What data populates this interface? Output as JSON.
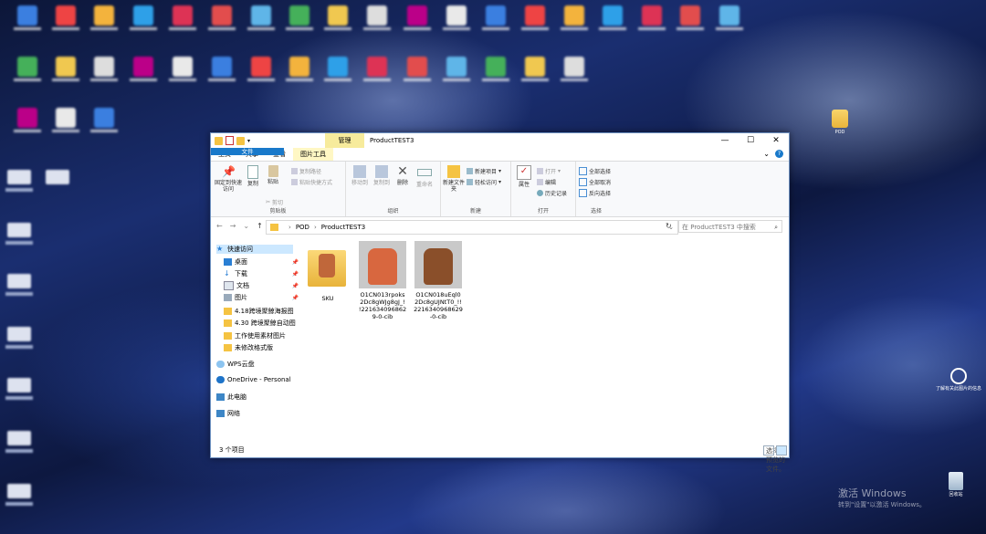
{
  "desktop": {
    "right_icons": [
      {
        "label": "POD",
        "icon": "folder-icon"
      },
      {
        "label": "了解有关此图片的信息",
        "icon": "info-camera-icon"
      },
      {
        "label": "回收站",
        "icon": "recycle-bin-icon"
      }
    ],
    "watermark_line1": "激活 Windows",
    "watermark_line2": "转到\"设置\"以激活 Windows。"
  },
  "explorer": {
    "title": "ProductTEST3",
    "manage_tab": "管理",
    "tabs": [
      {
        "label": "文件"
      },
      {
        "label": "主页"
      },
      {
        "label": "共享"
      },
      {
        "label": "查看"
      },
      {
        "label": "图片工具"
      }
    ],
    "ribbon": {
      "clipboard": {
        "pin": "固定到快速访问",
        "copy": "复制",
        "paste": "粘贴",
        "cut": "剪切",
        "copy_path": "复制路径",
        "paste_shortcut": "粘贴快捷方式",
        "group": "剪贴板"
      },
      "organize": {
        "move_to": "移动到",
        "copy_to": "复制到",
        "delete": "删除",
        "rename": "重命名",
        "group": "组织"
      },
      "new": {
        "new_folder": "新建文件夹",
        "new_item": "新建项目",
        "easy_access": "轻松访问",
        "group": "新建"
      },
      "open": {
        "properties": "属性",
        "open": "打开",
        "edit": "编辑",
        "history": "历史记录",
        "group": "打开"
      },
      "select": {
        "select_all": "全部选择",
        "select_none": "全部取消",
        "invert": "反向选择",
        "group": "选择"
      }
    },
    "address": {
      "crumbs": [
        "POD",
        "ProductTEST3"
      ],
      "search_placeholder": "在 ProductTEST3 中搜索"
    },
    "nav_pane": [
      {
        "label": "快速访问",
        "icon": "star-icon",
        "selected": true
      },
      {
        "label": "桌面",
        "icon": "desktop-icon",
        "pinned": true
      },
      {
        "label": "下载",
        "icon": "download-icon",
        "pinned": true
      },
      {
        "label": "文档",
        "icon": "document-icon",
        "pinned": true
      },
      {
        "label": "图片",
        "icon": "picture-icon",
        "pinned": true
      },
      {
        "label": "4.18跨境聚鲸海报图",
        "icon": "folder-icon"
      },
      {
        "label": "4.30 跨境聚鲸自动图",
        "icon": "folder-icon"
      },
      {
        "label": "工作使用素材图片",
        "icon": "folder-icon"
      },
      {
        "label": "未修改格式版",
        "icon": "folder-icon"
      },
      {
        "label": "WPS云盘",
        "icon": "cloud-icon"
      },
      {
        "label": "OneDrive - Personal",
        "icon": "onedrive-icon"
      },
      {
        "label": "此电脑",
        "icon": "computer-icon"
      },
      {
        "label": "网络",
        "icon": "network-icon"
      }
    ],
    "files": [
      {
        "name": "SKU",
        "type": "folder"
      },
      {
        "name_lines": [
          "O1CN013rpoks",
          "2Dc8gWJg8gJ_!",
          "!221634096862",
          "9-0-cib"
        ],
        "type": "image",
        "color": "#d8673f"
      },
      {
        "name_lines": [
          "O1CN018uEql0",
          "2Dc8gUJNtT0_!!",
          "2216340968629",
          "-0-cib"
        ],
        "type": "image",
        "color": "#8a4f2a"
      }
    ],
    "preview_hint": "选择要预览的文件。",
    "status": "3 个项目"
  }
}
